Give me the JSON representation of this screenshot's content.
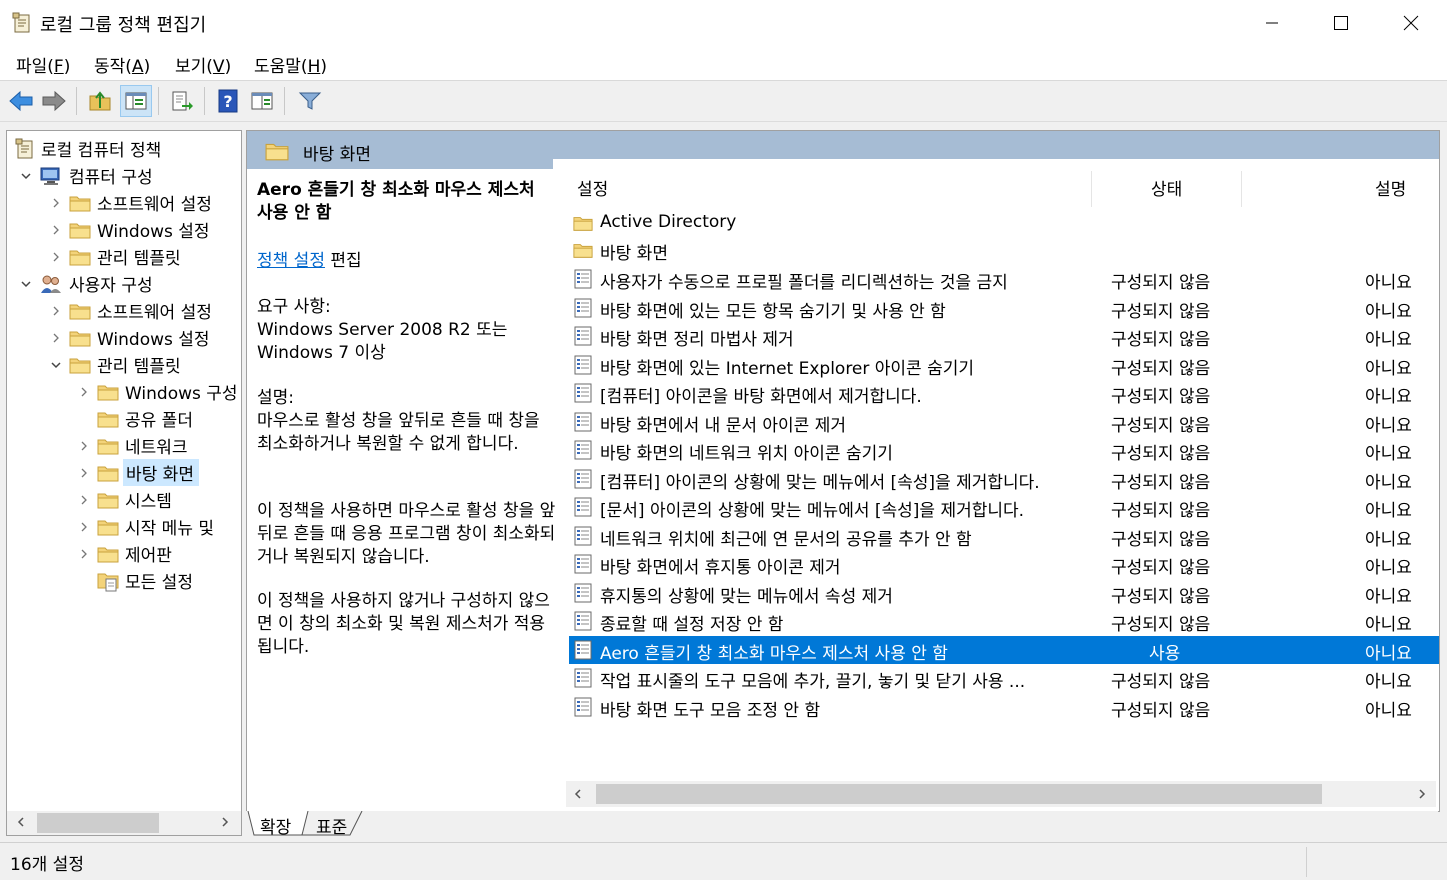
{
  "window": {
    "title": "로컬 그룹 정책 편집기",
    "icon": "policy-editor-icon"
  },
  "menu": {
    "file": "파일",
    "file_key": "F",
    "action": "동작",
    "action_key": "A",
    "view": "보기",
    "view_key": "V",
    "help": "도움말",
    "help_key": "H"
  },
  "toolbar": {
    "buttons": [
      "back-arrow-icon",
      "forward-arrow-icon",
      "up-folder-icon",
      "show-hide-tree-icon",
      "export-list-icon",
      "help-icon",
      "extended-view-icon",
      "filter-icon"
    ]
  },
  "tree": {
    "root": "로컬 컴퓨터 정책",
    "computer": "컴퓨터 구성",
    "c_software": "소프트웨어 설정",
    "c_windows": "Windows 설정",
    "c_admin": "관리 템플릿",
    "user": "사용자 구성",
    "u_software": "소프트웨어 설정",
    "u_windows": "Windows 설정",
    "u_admin": "관리 템플릿",
    "u_windows_comp": "Windows 구성",
    "u_shared": "공유 폴더",
    "u_network": "네트워크",
    "u_desktop": "바탕 화면",
    "u_system": "시스템",
    "u_start": "시작 메뉴 및",
    "u_control": "제어판",
    "u_all": "모든 설정"
  },
  "pane": {
    "header": "바탕 화면",
    "desc_title": "Aero 흔들기 창 최소화 마우스 제스처 사용 안 함",
    "edit_link": "정책 설정",
    "edit_suffix": "편집",
    "req_label": "요구 사항:",
    "req_text": "Windows Server 2008 R2 또는 Windows 7 이상",
    "desc_label": "설명:",
    "desc_p1": "마우스로 활성 창을 앞뒤로 흔들 때 창을 최소화하거나 복원할 수 없게 합니다.",
    "desc_p2": "이 정책을 사용하면 마우스로 활성 창을 앞뒤로 흔들 때 응용 프로그램 창이 최소화되거나 복원되지 않습니다.",
    "desc_p3": "이 정책을 사용하지 않거나 구성하지 않으면 이 창의 최소화 및 복원 제스처가 적용됩니다."
  },
  "list": {
    "columns": {
      "name": "설정",
      "state": "상태",
      "comment": "설명"
    },
    "folders": [
      "Active Directory",
      "바탕 화면"
    ],
    "rows": [
      {
        "name": "사용자가 수동으로 프로필 폴더를 리디렉션하는 것을 금지",
        "state": "구성되지 않음",
        "comment": "아니요"
      },
      {
        "name": "바탕 화면에 있는 모든 항목 숨기기 및 사용 안 함",
        "state": "구성되지 않음",
        "comment": "아니요"
      },
      {
        "name": "바탕 화면 정리 마법사 제거",
        "state": "구성되지 않음",
        "comment": "아니요"
      },
      {
        "name": "바탕 화면에 있는 Internet Explorer 아이콘 숨기기",
        "state": "구성되지 않음",
        "comment": "아니요"
      },
      {
        "name": "[컴퓨터] 아이콘을 바탕 화면에서 제거합니다.",
        "state": "구성되지 않음",
        "comment": "아니요"
      },
      {
        "name": "바탕 화면에서 내 문서 아이콘 제거",
        "state": "구성되지 않음",
        "comment": "아니요"
      },
      {
        "name": "바탕 화면의 네트워크 위치 아이콘 숨기기",
        "state": "구성되지 않음",
        "comment": "아니요"
      },
      {
        "name": "[컴퓨터] 아이콘의 상황에 맞는 메뉴에서 [속성]을 제거합니다.",
        "state": "구성되지 않음",
        "comment": "아니요"
      },
      {
        "name": "[문서] 아이콘의 상황에 맞는 메뉴에서 [속성]을 제거합니다.",
        "state": "구성되지 않음",
        "comment": "아니요"
      },
      {
        "name": "네트워크 위치에 최근에 연 문서의 공유를 추가 안 함",
        "state": "구성되지 않음",
        "comment": "아니요"
      },
      {
        "name": "바탕 화면에서 휴지통 아이콘 제거",
        "state": "구성되지 않음",
        "comment": "아니요"
      },
      {
        "name": "휴지통의 상황에 맞는 메뉴에서 속성 제거",
        "state": "구성되지 않음",
        "comment": "아니요"
      },
      {
        "name": "종료할 때 설정 저장 안 함",
        "state": "구성되지 않음",
        "comment": "아니요"
      },
      {
        "name": "Aero 흔들기 창 최소화 마우스 제스처 사용 안 함",
        "state": "사용",
        "comment": "아니요"
      },
      {
        "name": "작업 표시줄의 도구 모음에 추가, 끌기, 놓기 및 닫기 사용 ...",
        "state": "구성되지 않음",
        "comment": "아니요"
      },
      {
        "name": "바탕 화면 도구 모음 조정 안 함",
        "state": "구성되지 않음",
        "comment": "아니요"
      }
    ]
  },
  "tabs": {
    "extended": "확장",
    "standard": "표준"
  },
  "status": {
    "count": "16개 설정"
  }
}
